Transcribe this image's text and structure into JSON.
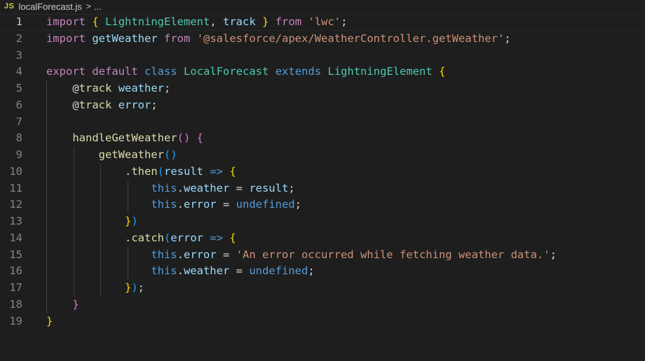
{
  "breadcrumb": {
    "file_icon": "JS",
    "file_name": "localForecast.js",
    "separator": ">",
    "trail": "..."
  },
  "editor": {
    "current_line": 1,
    "lines": [
      {
        "n": "1",
        "indent": 0,
        "tokens": [
          [
            "kw",
            "import"
          ],
          [
            "op",
            " "
          ],
          [
            "b1",
            "{"
          ],
          [
            "op",
            " "
          ],
          [
            "cls",
            "LightningElement"
          ],
          [
            "op",
            ", "
          ],
          [
            "var",
            "track"
          ],
          [
            "op",
            " "
          ],
          [
            "b1",
            "}"
          ],
          [
            "op",
            " "
          ],
          [
            "kw",
            "from"
          ],
          [
            "op",
            " "
          ],
          [
            "str",
            "'lwc'"
          ],
          [
            "op",
            ";"
          ]
        ]
      },
      {
        "n": "2",
        "indent": 0,
        "tokens": [
          [
            "kw",
            "import"
          ],
          [
            "op",
            " "
          ],
          [
            "var",
            "getWeather"
          ],
          [
            "op",
            " "
          ],
          [
            "kw",
            "from"
          ],
          [
            "op",
            " "
          ],
          [
            "str",
            "'@salesforce/apex/WeatherController.getWeather'"
          ],
          [
            "op",
            ";"
          ]
        ]
      },
      {
        "n": "3",
        "indent": 0,
        "tokens": []
      },
      {
        "n": "4",
        "indent": 0,
        "tokens": [
          [
            "kw",
            "export"
          ],
          [
            "op",
            " "
          ],
          [
            "kw",
            "default"
          ],
          [
            "op",
            " "
          ],
          [
            "st",
            "class"
          ],
          [
            "op",
            " "
          ],
          [
            "cls",
            "LocalForecast"
          ],
          [
            "op",
            " "
          ],
          [
            "st",
            "extends"
          ],
          [
            "op",
            " "
          ],
          [
            "cls",
            "LightningElement"
          ],
          [
            "op",
            " "
          ],
          [
            "b1",
            "{"
          ]
        ]
      },
      {
        "n": "5",
        "indent": 1,
        "tokens": [
          [
            "op",
            "    @"
          ],
          [
            "fn",
            "track"
          ],
          [
            "op",
            " "
          ],
          [
            "var",
            "weather"
          ],
          [
            "op",
            ";"
          ]
        ]
      },
      {
        "n": "6",
        "indent": 1,
        "tokens": [
          [
            "op",
            "    @"
          ],
          [
            "fn",
            "track"
          ],
          [
            "op",
            " "
          ],
          [
            "var",
            "error"
          ],
          [
            "op",
            ";"
          ]
        ]
      },
      {
        "n": "7",
        "indent": 1,
        "tokens": []
      },
      {
        "n": "8",
        "indent": 1,
        "tokens": [
          [
            "op",
            "    "
          ],
          [
            "fn",
            "handleGetWeather"
          ],
          [
            "b2",
            "()"
          ],
          [
            "op",
            " "
          ],
          [
            "b2",
            "{"
          ]
        ]
      },
      {
        "n": "9",
        "indent": 2,
        "tokens": [
          [
            "op",
            "        "
          ],
          [
            "fn",
            "getWeather"
          ],
          [
            "b3",
            "()"
          ]
        ]
      },
      {
        "n": "10",
        "indent": 3,
        "tokens": [
          [
            "op",
            "            ."
          ],
          [
            "fn",
            "then"
          ],
          [
            "b3",
            "("
          ],
          [
            "var",
            "result"
          ],
          [
            "op",
            " "
          ],
          [
            "st",
            "=>"
          ],
          [
            "op",
            " "
          ],
          [
            "b1",
            "{"
          ]
        ]
      },
      {
        "n": "11",
        "indent": 4,
        "tokens": [
          [
            "op",
            "                "
          ],
          [
            "st",
            "this"
          ],
          [
            "op",
            "."
          ],
          [
            "var",
            "weather"
          ],
          [
            "op",
            " = "
          ],
          [
            "var",
            "result"
          ],
          [
            "op",
            ";"
          ]
        ]
      },
      {
        "n": "12",
        "indent": 4,
        "tokens": [
          [
            "op",
            "                "
          ],
          [
            "st",
            "this"
          ],
          [
            "op",
            "."
          ],
          [
            "var",
            "error"
          ],
          [
            "op",
            " = "
          ],
          [
            "st",
            "undefined"
          ],
          [
            "op",
            ";"
          ]
        ]
      },
      {
        "n": "13",
        "indent": 3,
        "tokens": [
          [
            "op",
            "            "
          ],
          [
            "b1",
            "}"
          ],
          [
            "b3",
            ")"
          ]
        ]
      },
      {
        "n": "14",
        "indent": 3,
        "tokens": [
          [
            "op",
            "            ."
          ],
          [
            "fn",
            "catch"
          ],
          [
            "b3",
            "("
          ],
          [
            "var",
            "error"
          ],
          [
            "op",
            " "
          ],
          [
            "st",
            "=>"
          ],
          [
            "op",
            " "
          ],
          [
            "b1",
            "{"
          ]
        ]
      },
      {
        "n": "15",
        "indent": 4,
        "tokens": [
          [
            "op",
            "                "
          ],
          [
            "st",
            "this"
          ],
          [
            "op",
            "."
          ],
          [
            "var",
            "error"
          ],
          [
            "op",
            " = "
          ],
          [
            "str",
            "'An error occurred while fetching weather data.'"
          ],
          [
            "op",
            ";"
          ]
        ]
      },
      {
        "n": "16",
        "indent": 4,
        "tokens": [
          [
            "op",
            "                "
          ],
          [
            "st",
            "this"
          ],
          [
            "op",
            "."
          ],
          [
            "var",
            "weather"
          ],
          [
            "op",
            " = "
          ],
          [
            "st",
            "undefined"
          ],
          [
            "op",
            ";"
          ]
        ]
      },
      {
        "n": "17",
        "indent": 3,
        "tokens": [
          [
            "op",
            "            "
          ],
          [
            "b1",
            "}"
          ],
          [
            "b3",
            ")"
          ],
          [
            "op",
            ";"
          ]
        ]
      },
      {
        "n": "18",
        "indent": 1,
        "tokens": [
          [
            "op",
            "    "
          ],
          [
            "b2",
            "}"
          ]
        ]
      },
      {
        "n": "19",
        "indent": 0,
        "tokens": [
          [
            "b1",
            "}"
          ]
        ]
      }
    ]
  }
}
